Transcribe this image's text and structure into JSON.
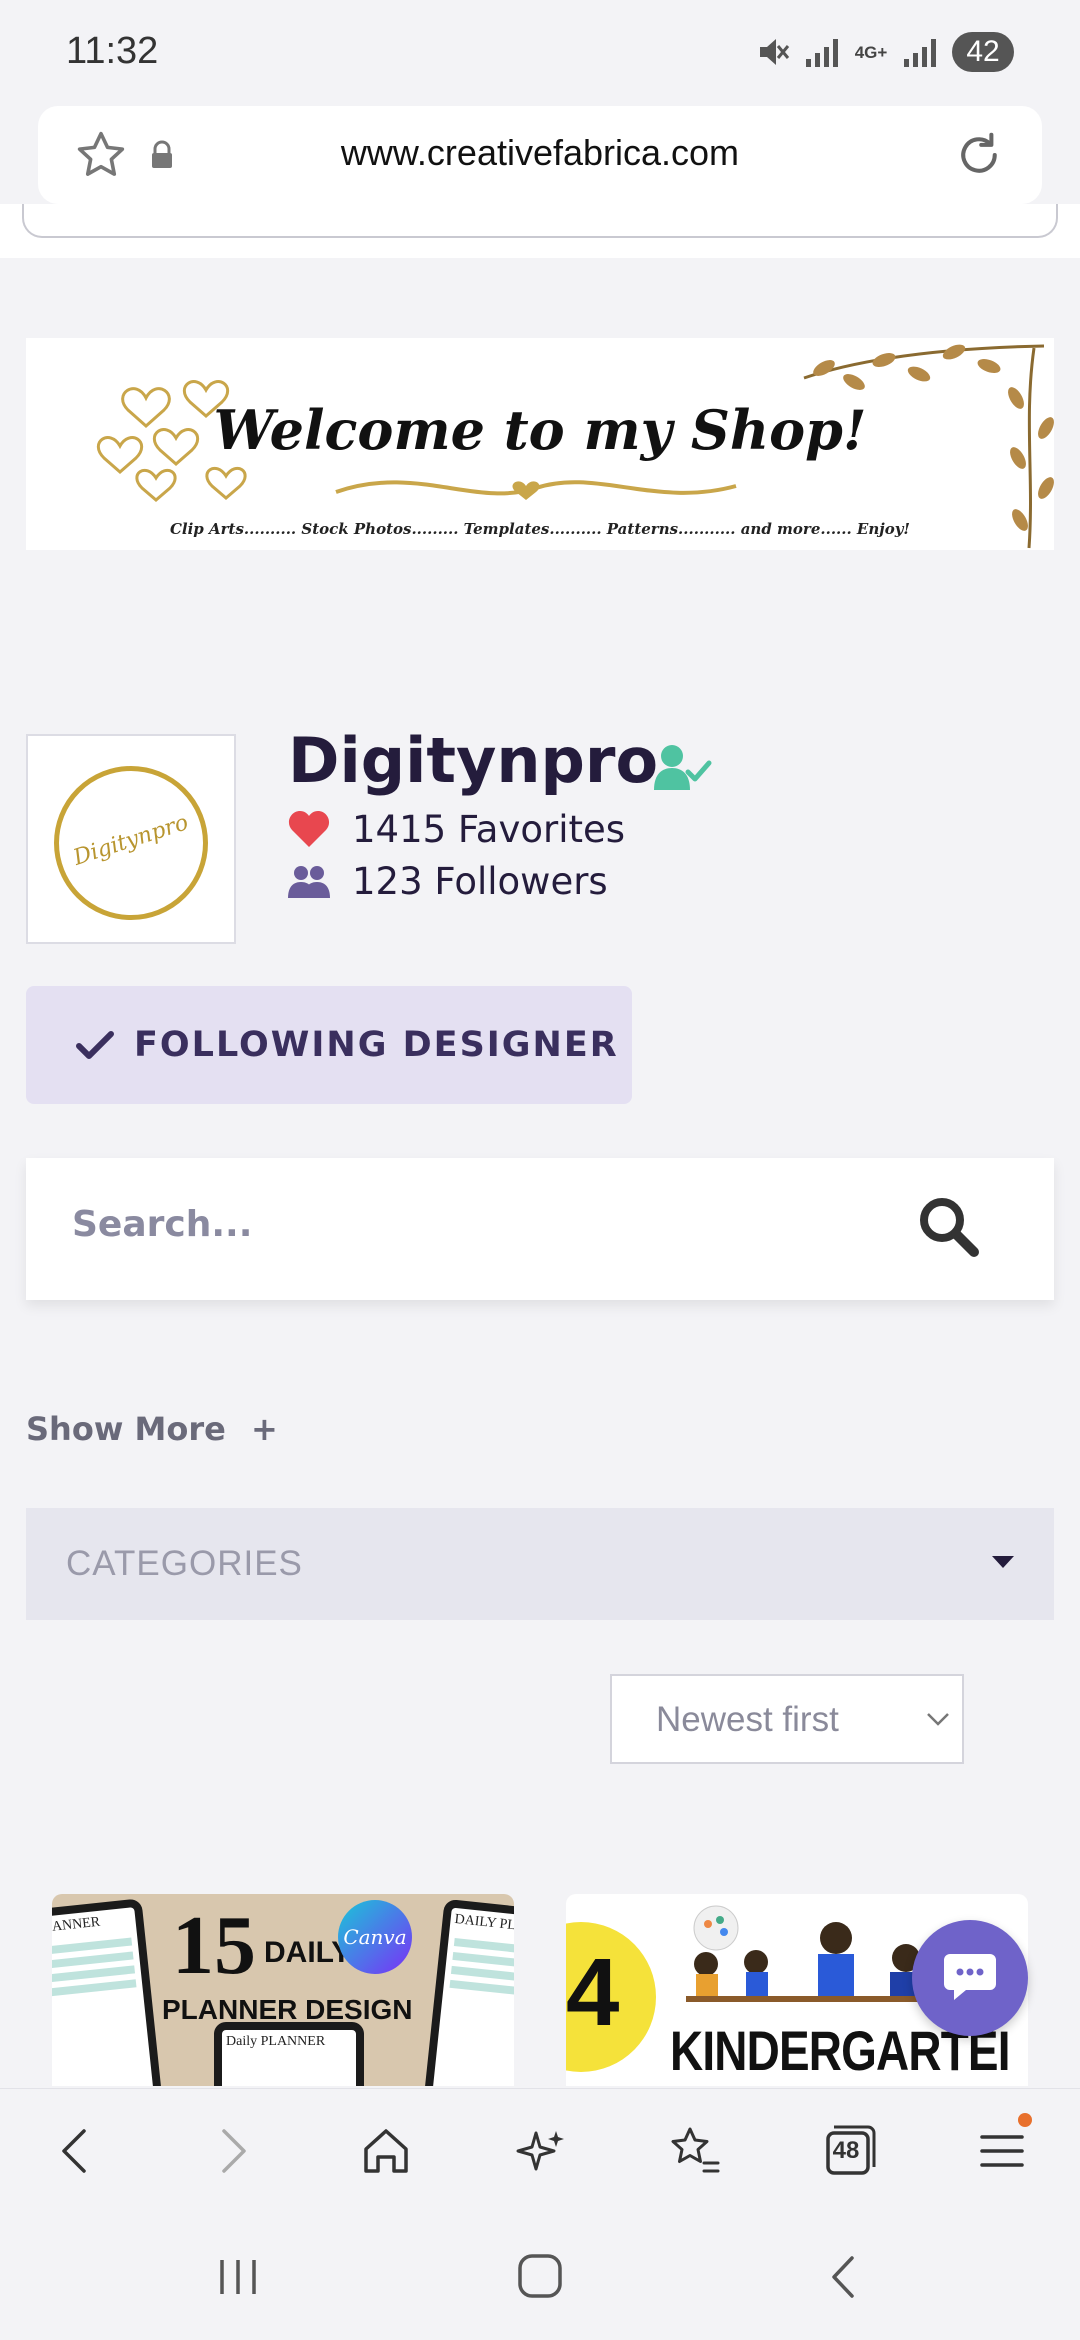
{
  "status_bar": {
    "time": "11:32",
    "network": "4G+",
    "battery": "42",
    "icons": [
      "mute-icon",
      "signal-icon",
      "network-4g-icon",
      "signal-icon",
      "battery-icon"
    ]
  },
  "browser": {
    "url": "www.creativefabrica.com",
    "icons": [
      "star-icon",
      "lock-icon",
      "reload-icon"
    ]
  },
  "banner": {
    "title": "Welcome to my Shop!",
    "subtitle": "Clip Arts.......... Stock Photos......... Templates.......... Patterns........... and more...... Enjoy!"
  },
  "designer": {
    "avatar_text": "Digitynpro",
    "name": "Digitynpro",
    "favorites": "1415 Favorites",
    "followers": "123 Followers",
    "follow_button": "FOLLOWING DESIGNER"
  },
  "search": {
    "placeholder": "Search..."
  },
  "filters": {
    "show_more": "Show More",
    "show_more_symbol": "+",
    "categories_label": "CATEGORIES",
    "sort_selected": "Newest first"
  },
  "products": [
    {
      "number": "15",
      "daily": "DAILY",
      "subtitle": "PLANNER DESIGN",
      "badge": "Canva",
      "tablet_left": "PLANNER",
      "tablet_right": "DAILY PL",
      "tablet_mid": "Daily PLANNER"
    },
    {
      "number": "4",
      "title": "KINDERGARTEI"
    }
  ],
  "toolbar": {
    "tabs_count": "48",
    "icons": [
      "back-icon",
      "forward-icon",
      "home-icon",
      "sparkle-icon",
      "bookmarks-icon",
      "tabs-icon",
      "menu-icon"
    ]
  },
  "colors": {
    "brand_dark": "#241c3c",
    "follow_bg": "#e4e0f2",
    "verified": "#4fc3a1",
    "heart": "#e8474f",
    "chat": "#6f63c9",
    "gold": "#c8a437"
  }
}
